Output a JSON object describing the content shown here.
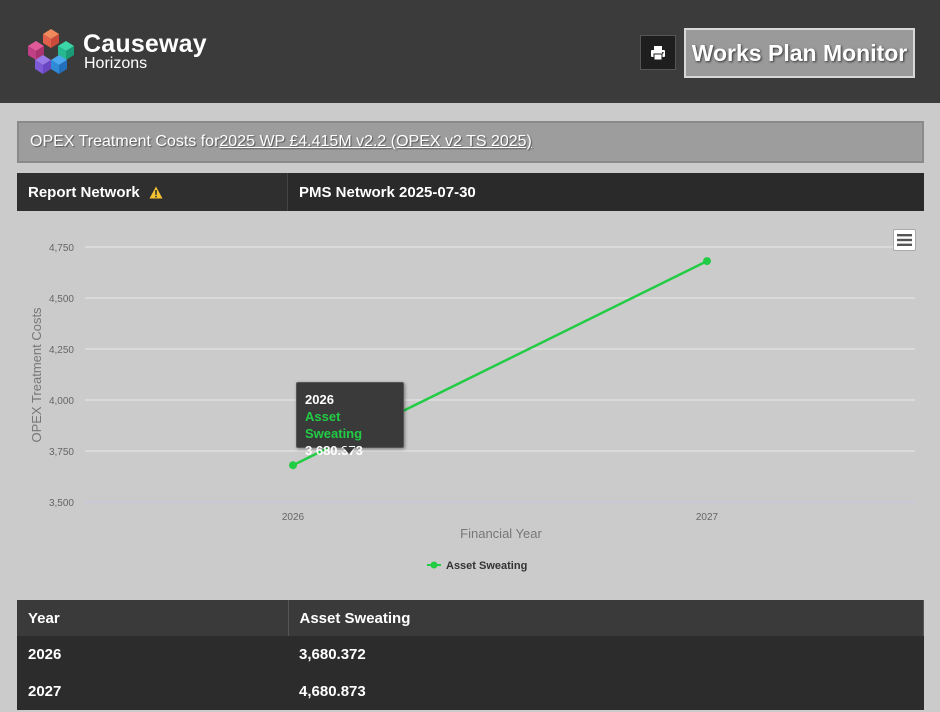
{
  "header": {
    "brand_name": "Causeway",
    "brand_sub": "Horizons",
    "app_title": "Works Plan Monitor",
    "print_icon": "printer-icon"
  },
  "report": {
    "title_prefix": "OPEX Treatment Costs for ",
    "title_link": "2025 WP £4.415M v2.2 (OPEX v2 TS 2025)",
    "network_label": "Report Network",
    "network_value": "PMS Network 2025-07-30"
  },
  "colors": {
    "series": "#22cc44",
    "header_bg": "#3b3b3b",
    "page_bg": "#cbcbcb"
  },
  "chart_data": {
    "type": "line",
    "xlabel": "Financial Year",
    "ylabel": "OPEX Treatment Costs",
    "x": [
      "2026",
      "2027"
    ],
    "series": [
      {
        "name": "Asset Sweating",
        "values": [
          3680.373,
          4680.873
        ]
      }
    ],
    "ylim": [
      3500,
      4750
    ],
    "yticks": [
      3500,
      3750,
      4000,
      4250,
      4500,
      4750
    ],
    "ytick_labels": [
      "3,500",
      "3,750",
      "4,000",
      "4,250",
      "4,500",
      "4,750"
    ],
    "grid": true,
    "legend": "bottom-center"
  },
  "tooltip": {
    "year": "2026",
    "series": "Asset Sweating",
    "value": "3 680.373"
  },
  "table": {
    "headers": [
      "Year",
      "Asset Sweating"
    ],
    "rows": [
      [
        "2026",
        "3,680.372"
      ],
      [
        "2027",
        "4,680.873"
      ]
    ]
  }
}
